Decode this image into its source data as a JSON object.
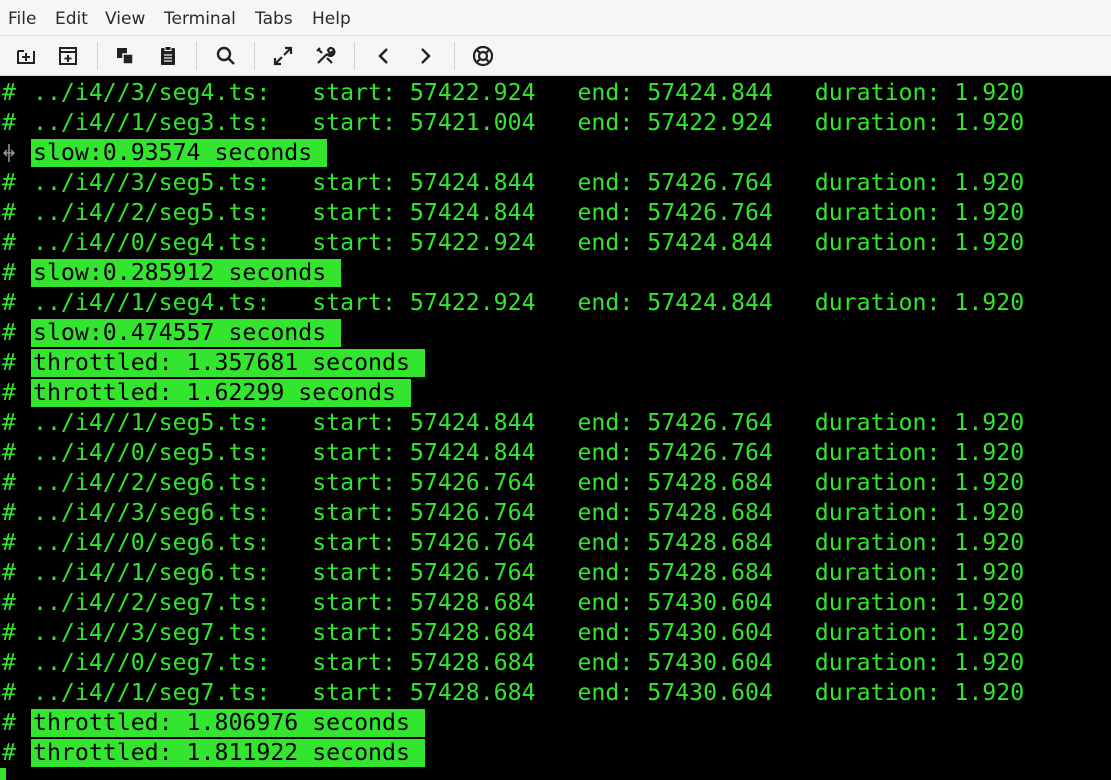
{
  "menu": [
    {
      "label": "File"
    },
    {
      "label": "Edit"
    },
    {
      "label": "View"
    },
    {
      "label": "Terminal"
    },
    {
      "label": "Tabs"
    },
    {
      "label": "Help"
    }
  ],
  "toolbar": {
    "buttons": [
      {
        "name": "new-tab-icon"
      },
      {
        "name": "new-window-icon"
      },
      {
        "name": "copy-icon"
      },
      {
        "name": "paste-icon"
      },
      {
        "name": "search-icon"
      },
      {
        "name": "fullscreen-icon"
      },
      {
        "name": "preferences-icon"
      },
      {
        "name": "previous-tab-icon"
      },
      {
        "name": "next-tab-icon"
      },
      {
        "name": "help-icon"
      }
    ]
  },
  "terminal": {
    "colors": {
      "text": "#33e52e",
      "background": "#000000"
    },
    "lines": [
      {
        "prefix": "#",
        "text": "../i4//3/seg4.ts:   start: 57422.924   end: 57424.844   duration: 1.920",
        "highlight": false
      },
      {
        "prefix": "#",
        "text": "../i4//1/seg3.ts:   start: 57421.004   end: 57422.924   duration: 1.920",
        "highlight": false
      },
      {
        "prefix": "",
        "text": "slow:0.93574 seconds",
        "highlight": true
      },
      {
        "prefix": "#",
        "text": "../i4//3/seg5.ts:   start: 57424.844   end: 57426.764   duration: 1.920",
        "highlight": false
      },
      {
        "prefix": "#",
        "text": "../i4//2/seg5.ts:   start: 57424.844   end: 57426.764   duration: 1.920",
        "highlight": false
      },
      {
        "prefix": "#",
        "text": "../i4//0/seg4.ts:   start: 57422.924   end: 57424.844   duration: 1.920",
        "highlight": false
      },
      {
        "prefix": "#",
        "text": "slow:0.285912 seconds",
        "highlight": true
      },
      {
        "prefix": "#",
        "text": "../i4//1/seg4.ts:   start: 57422.924   end: 57424.844   duration: 1.920",
        "highlight": false
      },
      {
        "prefix": "#",
        "text": "slow:0.474557 seconds",
        "highlight": true
      },
      {
        "prefix": "#",
        "text": "throttled: 1.357681 seconds",
        "highlight": true
      },
      {
        "prefix": "#",
        "text": "throttled: 1.62299 seconds",
        "highlight": true
      },
      {
        "prefix": "#",
        "text": "../i4//1/seg5.ts:   start: 57424.844   end: 57426.764   duration: 1.920",
        "highlight": false
      },
      {
        "prefix": "#",
        "text": "../i4//0/seg5.ts:   start: 57424.844   end: 57426.764   duration: 1.920",
        "highlight": false
      },
      {
        "prefix": "#",
        "text": "../i4//2/seg6.ts:   start: 57426.764   end: 57428.684   duration: 1.920",
        "highlight": false
      },
      {
        "prefix": "#",
        "text": "../i4//3/seg6.ts:   start: 57426.764   end: 57428.684   duration: 1.920",
        "highlight": false
      },
      {
        "prefix": "#",
        "text": "../i4//0/seg6.ts:   start: 57426.764   end: 57428.684   duration: 1.920",
        "highlight": false
      },
      {
        "prefix": "#",
        "text": "../i4//1/seg6.ts:   start: 57426.764   end: 57428.684   duration: 1.920",
        "highlight": false
      },
      {
        "prefix": "#",
        "text": "../i4//2/seg7.ts:   start: 57428.684   end: 57430.604   duration: 1.920",
        "highlight": false
      },
      {
        "prefix": "#",
        "text": "../i4//3/seg7.ts:   start: 57428.684   end: 57430.604   duration: 1.920",
        "highlight": false
      },
      {
        "prefix": "#",
        "text": "../i4//0/seg7.ts:   start: 57428.684   end: 57430.604   duration: 1.920",
        "highlight": false
      },
      {
        "prefix": "#",
        "text": "../i4//1/seg7.ts:   start: 57428.684   end: 57430.604   duration: 1.920",
        "highlight": false
      },
      {
        "prefix": "#",
        "text": "throttled: 1.806976 seconds",
        "highlight": true
      },
      {
        "prefix": "#",
        "text": "throttled: 1.811922 seconds",
        "highlight": true
      }
    ]
  }
}
